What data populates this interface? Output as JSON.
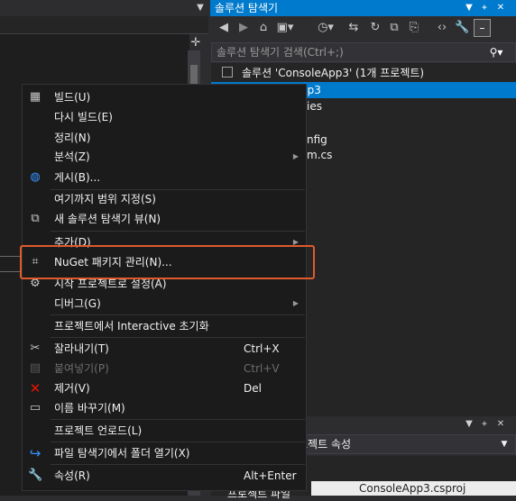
{
  "solution_explorer": {
    "title": "솔루션 탐색기",
    "search_placeholder": "솔루션 탐색기 검색(Ctrl+;)",
    "tree": [
      "솔루션 'ConsoleApp3' (1개 프로젝트)",
      "pp3",
      "ies",
      "",
      "nfig",
      "m.cs"
    ]
  },
  "properties_panel": {
    "combo_value": "로젝트 속성",
    "filename_value": "ConsoleApp3.csproj",
    "property_name_partial": "프로젝트 파일"
  },
  "context_menu": {
    "items": [
      {
        "label": "빌드(U)",
        "shortcut": "",
        "icon": "build-icon",
        "disabled": false
      },
      {
        "label": "다시 빌드(E)",
        "shortcut": "",
        "icon": "",
        "disabled": false
      },
      {
        "label": "정리(N)",
        "shortcut": "",
        "icon": "",
        "disabled": false
      },
      {
        "label": "분석(Z)",
        "shortcut": "",
        "icon": "",
        "disabled": false,
        "submenu": true
      },
      {
        "label": "게시(B)...",
        "shortcut": "",
        "icon": "globe-icon",
        "disabled": false
      },
      {
        "label": "여기까지 범위 지정(S)",
        "shortcut": "",
        "icon": "",
        "disabled": false
      },
      {
        "label": "새 솔루션 탐색기 뷰(N)",
        "shortcut": "",
        "icon": "new-view-icon",
        "disabled": false
      },
      {
        "label": "추가(D)",
        "shortcut": "",
        "icon": "",
        "disabled": false,
        "submenu": true
      },
      {
        "label": "NuGet 패키지 관리(N)...",
        "shortcut": "",
        "icon": "nuget-icon",
        "disabled": false
      },
      {
        "label": "시작 프로젝트로 설정(A)",
        "shortcut": "",
        "icon": "gear-icon",
        "disabled": false
      },
      {
        "label": "디버그(G)",
        "shortcut": "",
        "icon": "",
        "disabled": false,
        "submenu": true
      },
      {
        "label": "프로젝트에서 Interactive 초기화",
        "shortcut": "",
        "icon": "",
        "disabled": false
      },
      {
        "label": "잘라내기(T)",
        "shortcut": "Ctrl+X",
        "icon": "scissors-icon",
        "disabled": false
      },
      {
        "label": "붙여넣기(P)",
        "shortcut": "Ctrl+V",
        "icon": "paste-icon",
        "disabled": true
      },
      {
        "label": "제거(V)",
        "shortcut": "Del",
        "icon": "delete-icon",
        "disabled": false
      },
      {
        "label": "이름 바꾸기(M)",
        "shortcut": "",
        "icon": "rename-icon",
        "disabled": false
      },
      {
        "label": "프로젝트 언로드(L)",
        "shortcut": "",
        "icon": "",
        "disabled": false
      },
      {
        "label": "파일 탐색기에서 폴더 열기(X)",
        "shortcut": "",
        "icon": "open-folder-icon",
        "disabled": false
      },
      {
        "label": "속성(R)",
        "shortcut": "Alt+Enter",
        "icon": "wrench-icon",
        "disabled": false
      }
    ]
  },
  "colors": {
    "accent": "#007acc",
    "highlight_box": "#e05a2b",
    "delete_icon": "#e51400",
    "open_folder_icon": "#3794ff"
  }
}
